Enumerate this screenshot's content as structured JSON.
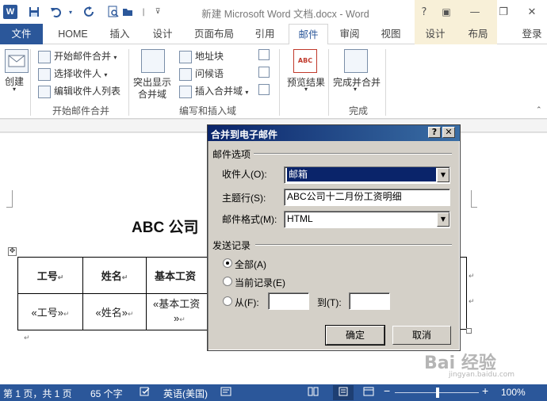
{
  "app": {
    "logo": "W",
    "title": "新建 Microsoft Word 文档.docx - Word",
    "window_controls": [
      "?",
      "▣",
      "—",
      "❐",
      "✕"
    ],
    "quick_access": [
      "save-icon",
      "undo-icon",
      "redo-icon",
      "print-preview-icon",
      "customize-icon"
    ]
  },
  "tabs": {
    "file": "文件",
    "home": "HOME",
    "insert": "插入",
    "design": "设计",
    "layout": "页面布局",
    "references": "引用",
    "mailings": "邮件",
    "review": "审阅",
    "view": "视图",
    "table_design": "设计",
    "table_layout": "布局",
    "login": "登录"
  },
  "ribbon": {
    "create": "创建",
    "start_merge": "开始邮件合并",
    "select_recipients": "选择收件人",
    "edit_recipients": "编辑收件人列表",
    "group_start": "开始邮件合并",
    "highlight_fields_1": "突出显示",
    "highlight_fields_2": "合并域",
    "address_block": "地址块",
    "greeting_line": "问候语",
    "insert_merge_field": "插入合并域",
    "group_write": "编写和插入域",
    "preview_results": "预览结果",
    "preview_badge": "ABC",
    "finish_merge": "完成并合并",
    "group_finish": "完成"
  },
  "document": {
    "heading": "ABC 公司",
    "table": {
      "headers": [
        "工号",
        "姓名",
        "基本工资"
      ],
      "row": [
        "«工号»",
        "«姓名»",
        "«基本工资"
      ],
      "row_cont": "»"
    },
    "para_mark": "↵",
    "move_handle": "✥"
  },
  "dialog": {
    "title": "合并到电子邮件",
    "help": "?",
    "close": "✕",
    "mail_options": "邮件选项",
    "to_label": "收件人(O):",
    "to_value": "邮箱",
    "subject_label": "主题行(S):",
    "subject_value": "ABC公司十二月份工资明细",
    "format_label": "邮件格式(M):",
    "format_value": "HTML",
    "send_records": "发送记录",
    "all": "全部(A)",
    "current": "当前记录(E)",
    "from": "从(F):",
    "to": "到(T):",
    "from_value": "",
    "to_range_value": "",
    "ok": "确定",
    "cancel": "取消"
  },
  "status": {
    "page": "第 1 页，共 1 页",
    "words": "65 个字",
    "language": "英语(美国)",
    "zoom": "100%",
    "zoom_minus": "−",
    "zoom_plus": "+"
  },
  "watermark": {
    "main": "Bai 经验",
    "sub": "jingyan.baidu.com"
  }
}
